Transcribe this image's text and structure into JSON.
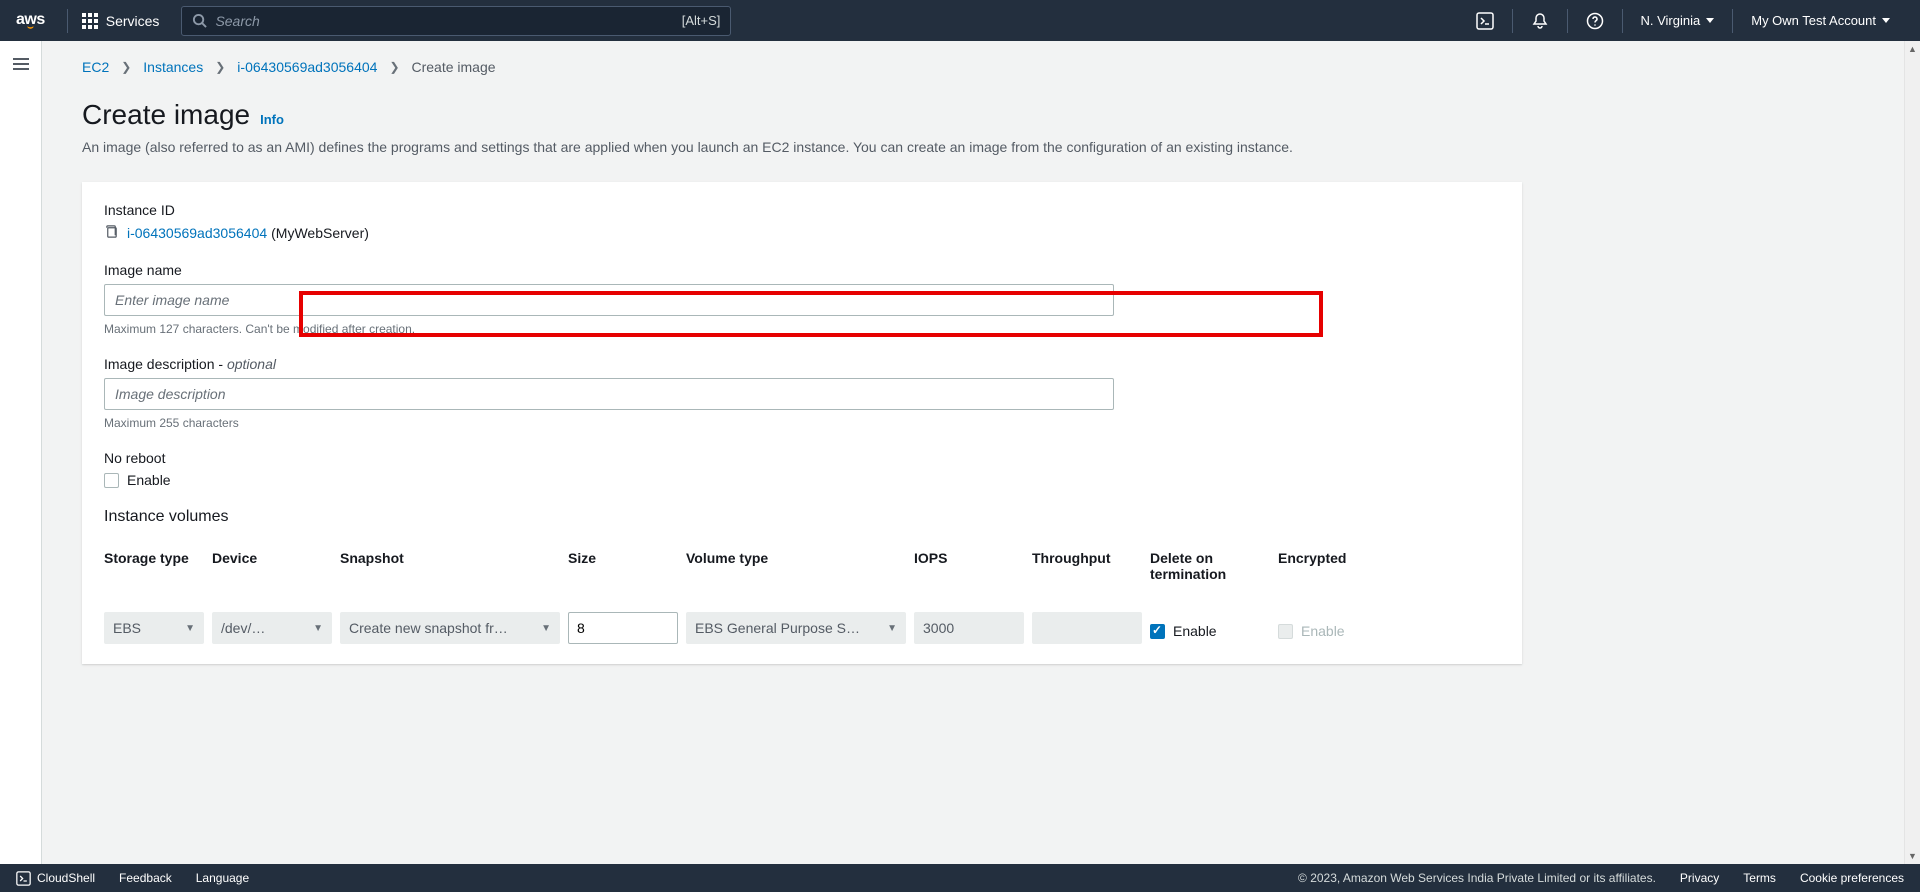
{
  "nav": {
    "logo": "aws",
    "services": "Services",
    "search_placeholder": "Search",
    "search_hint": "[Alt+S]",
    "region": "N. Virginia",
    "account": "My Own Test Account"
  },
  "breadcrumb": {
    "items": [
      "EC2",
      "Instances",
      "i-06430569ad3056404"
    ],
    "current": "Create image"
  },
  "page": {
    "title": "Create image",
    "info": "Info",
    "description": "An image (also referred to as an AMI) defines the programs and settings that are applied when you launch an EC2 instance. You can create an image from the configuration of an existing instance."
  },
  "form": {
    "instance_id_label": "Instance ID",
    "instance_id": "i-06430569ad3056404",
    "instance_name_suffix": "(MyWebServer)",
    "image_name_label": "Image name",
    "image_name_placeholder": "Enter image name",
    "image_name_hint": "Maximum 127 characters. Can't be modified after creation.",
    "image_desc_label": "Image description - ",
    "image_desc_optional": "optional",
    "image_desc_placeholder": "Image description",
    "image_desc_hint": "Maximum 255 characters",
    "no_reboot_label": "No reboot",
    "enable_label": "Enable",
    "volumes_header": "Instance volumes"
  },
  "volumes": {
    "headers": {
      "storage_type": "Storage type",
      "device": "Device",
      "snapshot": "Snapshot",
      "size": "Size",
      "volume_type": "Volume type",
      "iops": "IOPS",
      "throughput": "Throughput",
      "delete_on_term": "Delete on termination",
      "encrypted": "Encrypted"
    },
    "row": {
      "storage_type": "EBS",
      "device": "/dev/…",
      "snapshot": "Create new snapshot fr…",
      "size": "8",
      "volume_type": "EBS General Purpose S…",
      "iops": "3000",
      "throughput": "",
      "delete_on_term_checked": true,
      "delete_label": "Enable",
      "encrypted_checked": false,
      "encrypted_label": "Enable"
    }
  },
  "footer": {
    "cloudshell": "CloudShell",
    "feedback": "Feedback",
    "language": "Language",
    "copyright": "© 2023, Amazon Web Services India Private Limited or its affiliates.",
    "privacy": "Privacy",
    "terms": "Terms",
    "cookie": "Cookie preferences"
  }
}
